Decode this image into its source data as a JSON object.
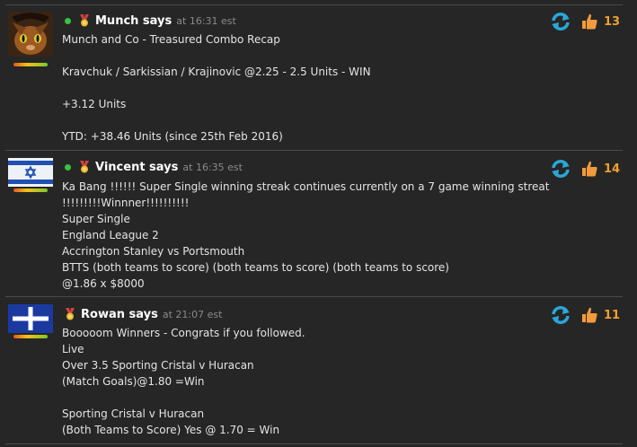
{
  "posts": [
    {
      "author": "Munch says",
      "time": "at 16:31 est",
      "online": true,
      "likes": "13",
      "avatar": "cat-avatar",
      "lines": [
        "Munch and Co - Treasured Combo Recap",
        "",
        "Kravchuk / Sarkissian / Krajinovic @2.25 - 2.5 Units - WIN",
        "",
        "+3.12 Units",
        "",
        "YTD: +38.46 Units (since 25th Feb 2016)"
      ]
    },
    {
      "author": "Vincent says",
      "time": "at 16:35 est",
      "online": true,
      "likes": "14",
      "avatar": "israel-flag-avatar",
      "lines": [
        "Ka Bang !!!!!! Super Single winning streak continues currently on a 7 game winning streat",
        "!!!!!!!!!Winnner!!!!!!!!!!",
        "Super Single",
        "England League 2",
        "Accrington Stanley vs Portsmouth",
        "BTTS (both teams to score) (both teams to score) (both teams to score)",
        "@1.86 x $8000"
      ]
    },
    {
      "author": "Rowan says",
      "time": "at 21:07 est",
      "online": false,
      "likes": "11",
      "avatar": "eureka-flag-avatar",
      "lines": [
        "Booooom Winners - Congrats if you followed.",
        "Live",
        "Over 3.5 Sporting Cristal v Huracan",
        "(Match Goals)@1.80 =Win",
        "",
        "Sporting Cristal v Huracan",
        "(Both Teams to Score) Yes @ 1.70 = Win"
      ]
    }
  ],
  "colors": {
    "background": "#262626",
    "author": "#ffffff",
    "timestamp": "#8a8a8a",
    "likes": "#f0a030",
    "online": "#39c23c",
    "refresh": "#2aa7d9",
    "thumb": "#f29b3c"
  }
}
